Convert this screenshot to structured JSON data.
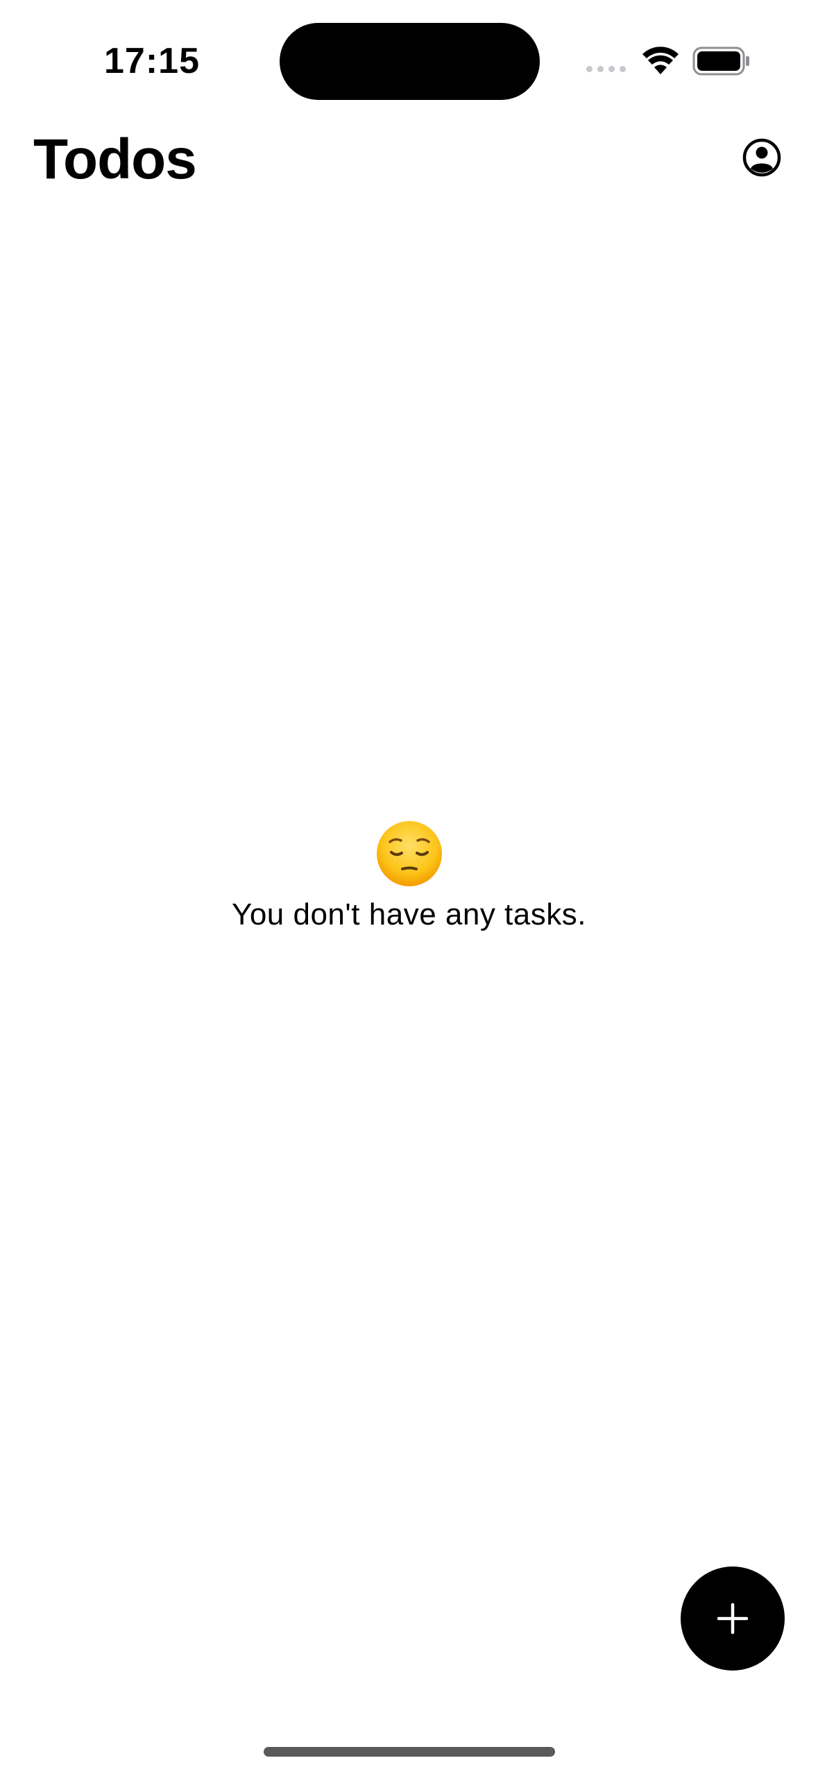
{
  "status_bar": {
    "time": "17:15",
    "wifi_icon": "wifi-icon",
    "battery_icon": "battery-icon"
  },
  "header": {
    "title": "Todos",
    "profile_icon": "person-circle-icon"
  },
  "empty_state": {
    "emoji_icon": "pensive-face-icon",
    "message": "You don't have any tasks."
  },
  "fab": {
    "icon": "plus-icon",
    "color": "#000000"
  }
}
